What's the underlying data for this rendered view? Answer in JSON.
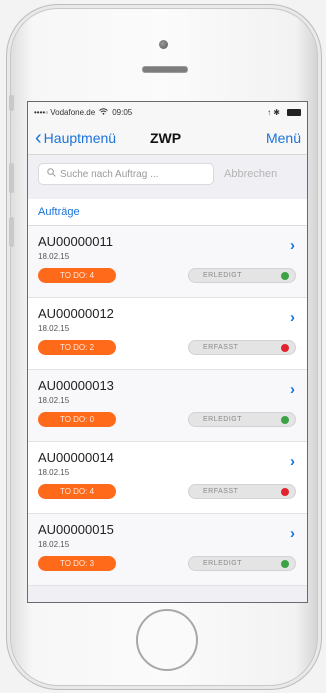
{
  "status_bar": {
    "carrier": "••••◦ Vodafone.de",
    "wifi_icon": "wifi-icon",
    "time": "09:05",
    "right": "↑ ✱"
  },
  "nav": {
    "back_label": "Hauptmenü",
    "title": "ZWP",
    "menu_label": "Menü"
  },
  "search": {
    "placeholder": "Suche nach Auftrag ...",
    "cancel_label": "Abbrechen"
  },
  "section_title": "Aufträge",
  "colors": {
    "accent": "#1a73d9",
    "todo": "#ff6a1a",
    "done": "#3aa443",
    "open": "#e0232f"
  },
  "orders": [
    {
      "id": "AU00000011",
      "date": "18.02.15",
      "todo": "TO DO: 4",
      "status": "ERLEDIGT",
      "status_color": "#3aa443"
    },
    {
      "id": "AU00000012",
      "date": "18.02.15",
      "todo": "TO DO: 2",
      "status": "ERFASST",
      "status_color": "#e0232f"
    },
    {
      "id": "AU00000013",
      "date": "18.02.15",
      "todo": "TO DO: 0",
      "status": "ERLEDIGT",
      "status_color": "#3aa443"
    },
    {
      "id": "AU00000014",
      "date": "18.02.15",
      "todo": "TO DO: 4",
      "status": "ERFASST",
      "status_color": "#e0232f"
    },
    {
      "id": "AU00000015",
      "date": "18.02.15",
      "todo": "TO DO: 3",
      "status": "ERLEDIGT",
      "status_color": "#3aa443"
    }
  ]
}
